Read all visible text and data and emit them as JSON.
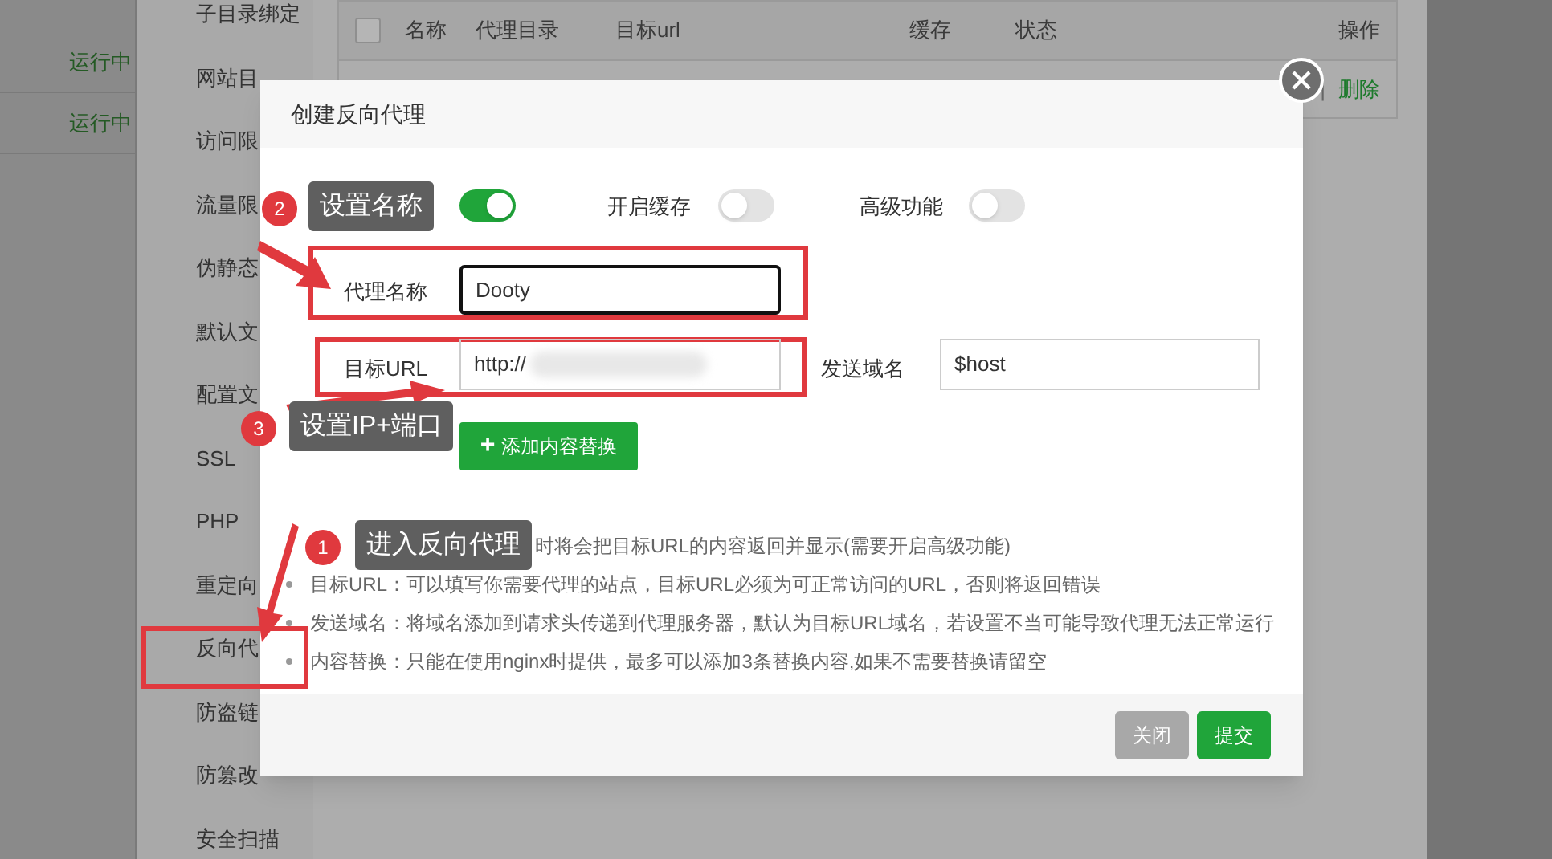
{
  "background": {
    "status_column": [
      "运行中",
      "运行中"
    ],
    "sidebar": [
      "子目录绑定",
      "网站目",
      "访问限",
      "流量限",
      "伪静态",
      "默认文",
      "配置文",
      "SSL",
      "PHP",
      "重定向",
      "反向代",
      "防盗链",
      "防篡改",
      "安全扫描"
    ],
    "table": {
      "select_all_checked": false,
      "columns": [
        "名称",
        "代理目录",
        "目标url",
        "缓存",
        "状态",
        "操作"
      ],
      "row_actions": [
        "|",
        "删除"
      ]
    }
  },
  "dialog": {
    "title": "创建反向代理",
    "toggles": [
      {
        "on": true
      },
      {
        "label": "开启缓存",
        "on": false
      },
      {
        "label": "高级功能",
        "on": false
      }
    ],
    "name_field": {
      "label": "代理名称",
      "value": "Dooty"
    },
    "target_field": {
      "label": "目标URL",
      "value": "http://"
    },
    "host_field": {
      "label": "发送域名",
      "value": "$host"
    },
    "add_button": {
      "icon": "+",
      "label": "添加内容替换"
    },
    "hints": [
      "时将会把目标URL的内容返回并显示(需要开启高级功能)",
      "目标URL：可以填写你需要代理的站点，目标URL必须为可正常访问的URL，否则将返回错误",
      "发送域名：将域名添加到请求头传递到代理服务器，默认为目标URL域名，若设置不当可能导致代理无法正常运行",
      "内容替换：只能在使用nginx时提供，最多可以添加3条替换内容,如果不需要替换请留空"
    ],
    "buttons": [
      {
        "kind": "close",
        "label": "关闭"
      },
      {
        "kind": "submit",
        "label": "提交"
      }
    ]
  },
  "annotations": [
    {
      "number": "2",
      "text": "设置名称"
    },
    {
      "number": "3",
      "text": "设置IP+端口"
    },
    {
      "number": "1",
      "text": "进入反向代理"
    }
  ]
}
